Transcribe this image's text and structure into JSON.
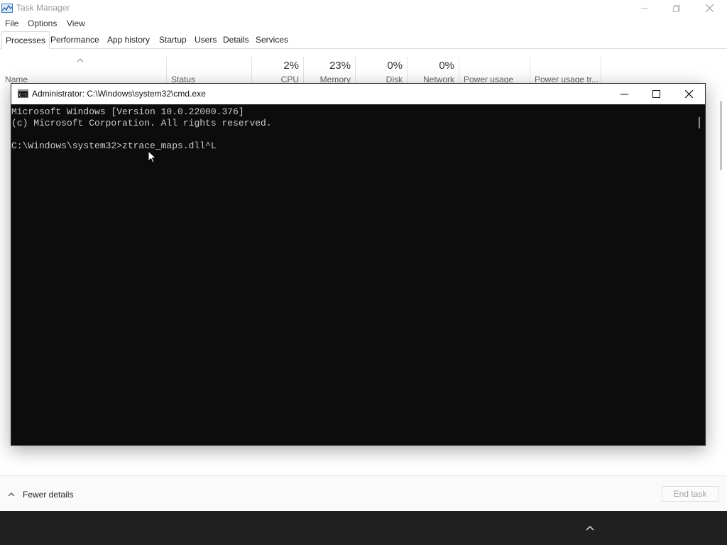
{
  "task_manager": {
    "title": "Task Manager",
    "menu": [
      "File",
      "Options",
      "View"
    ],
    "tabs": [
      "Processes",
      "Performance",
      "App history",
      "Startup",
      "Users",
      "Details",
      "Services"
    ],
    "active_tab": "Processes",
    "columns": {
      "name": "Name",
      "status": "Status",
      "cpu": {
        "pct": "2%",
        "label": "CPU"
      },
      "memory": {
        "pct": "23%",
        "label": "Memory"
      },
      "disk": {
        "pct": "0%",
        "label": "Disk"
      },
      "network": {
        "pct": "0%",
        "label": "Network"
      },
      "power_usage": "Power usage",
      "power_usage_trend": "Power usage tr..."
    },
    "footer": {
      "fewer_details": "Fewer details",
      "end_task": "End task"
    }
  },
  "cmd": {
    "title": "Administrator: C:\\Windows\\system32\\cmd.exe",
    "lines": [
      "Microsoft Windows [Version 10.0.22000.376]",
      "(c) Microsoft Corporation. All rights reserved.",
      "",
      "C:\\Windows\\system32>ztrace_maps.dll^L"
    ]
  },
  "colors": {
    "console_bg": "#0c0c0c",
    "console_text": "#cccccc",
    "taskbar_bg": "#202020"
  },
  "icons": [
    "task-manager-app-icon",
    "cmd-app-icon",
    "minimize-icon",
    "maximize-icon",
    "restore-icon",
    "close-icon",
    "sort-caret-icon",
    "chevron-up-icon",
    "mouse-cursor-icon"
  ]
}
